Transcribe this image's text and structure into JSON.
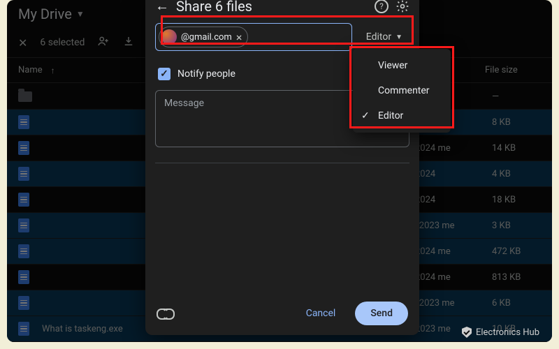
{
  "drive": {
    "location_label": "My Drive",
    "selection_label": "6 selected",
    "columns": {
      "name": "Name",
      "size": "File size"
    },
    "rows": [
      {
        "kind": "folder",
        "title": "",
        "modified": "",
        "size": "—",
        "selected": false
      },
      {
        "kind": "doc",
        "title": "",
        "modified": "",
        "size": "8 KB",
        "selected": true
      },
      {
        "kind": "doc",
        "title": "",
        "modified": "2024 me",
        "size": "14 KB",
        "selected": false
      },
      {
        "kind": "doc",
        "title": "",
        "modified": "2024",
        "size": "4 KB",
        "selected": true
      },
      {
        "kind": "doc",
        "title": "",
        "modified": "2024",
        "size": "18 KB",
        "selected": false
      },
      {
        "kind": "doc",
        "title": "",
        "modified": ", 2023 me",
        "size": "3 KB",
        "selected": true
      },
      {
        "kind": "doc",
        "title": "",
        "modified": "2024 me",
        "size": "472 KB",
        "selected": true
      },
      {
        "kind": "doc",
        "title": "",
        "modified": "2024 me",
        "size": "813 KB",
        "selected": false
      },
      {
        "kind": "doc",
        "title": "",
        "modified": ", 2023 me",
        "size": "6 KB",
        "selected": true
      },
      {
        "kind": "doc",
        "title": "What is taskeng.exe",
        "modified": "2023 me",
        "size": "10 KB",
        "selected": true
      }
    ]
  },
  "dialog": {
    "title": "Share 6 files",
    "recipient_email": "@gmail.com",
    "role_button_label": "Editor",
    "notify_label": "Notify people",
    "notify_checked": true,
    "message_placeholder": "Message",
    "cancel_label": "Cancel",
    "send_label": "Send"
  },
  "role_menu": {
    "items": [
      {
        "label": "Viewer",
        "selected": false
      },
      {
        "label": "Commenter",
        "selected": false
      },
      {
        "label": "Editor",
        "selected": true
      }
    ]
  },
  "watermark": "Electronics Hub"
}
